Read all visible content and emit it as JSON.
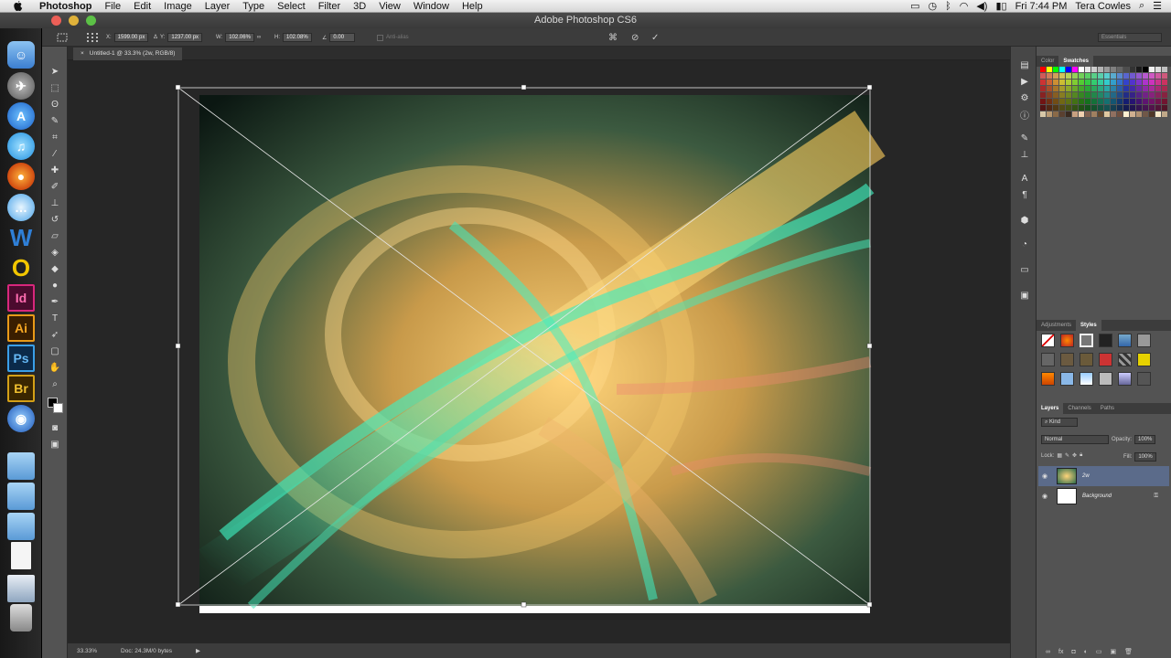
{
  "menubar": {
    "app": "Photoshop",
    "items": [
      "File",
      "Edit",
      "Image",
      "Layer",
      "Type",
      "Select",
      "Filter",
      "3D",
      "View",
      "Window",
      "Help"
    ],
    "clock": "Fri 7:44 PM",
    "user": "Tera Cowles"
  },
  "window": {
    "title": "Adobe Photoshop CS6"
  },
  "options": {
    "x_label": "X:",
    "x_value": "1599.00 px",
    "y_label": "Y:",
    "y_value": "1237.00 px",
    "w_label": "W:",
    "w_value": "102.06%",
    "h_label": "H:",
    "h_value": "102.08%",
    "angle_value": "0.00",
    "antialias": "Anti-alias",
    "workspace": "Essentials"
  },
  "document": {
    "tab_title": "Untitled-1 @ 33.3% (2w, RGB/8)",
    "close": "×"
  },
  "status": {
    "zoom": "33.33%",
    "doc": "Doc: 24.3M/0 bytes"
  },
  "color_panel": {
    "tabs": [
      "Color",
      "Swatches"
    ],
    "active": "Swatches"
  },
  "adjust_panel": {
    "tabs": [
      "Adjustments",
      "Styles"
    ],
    "active": "Styles"
  },
  "layers_panel": {
    "tabs": [
      "Layers",
      "Channels",
      "Paths"
    ],
    "active": "Layers",
    "kind": "Kind",
    "blend_mode": "Normal",
    "opacity_label": "Opacity:",
    "opacity": "100%",
    "lock_label": "Lock:",
    "fill_label": "Fill:",
    "fill": "100%",
    "layers": [
      {
        "name": "2w",
        "selected": true
      },
      {
        "name": "Background",
        "selected": false
      }
    ]
  },
  "dock_icons": [
    "finder-icon",
    "launchpad-icon",
    "app-store-icon",
    "itunes-icon",
    "firefox-icon",
    "messages-icon",
    "word-icon",
    "openoffice-icon",
    "indesign-icon",
    "illustrator-icon",
    "photoshop-icon",
    "bridge-icon",
    "safari-icon",
    "folder-icon",
    "folder-icon",
    "folder-icon",
    "document-icon",
    "preview-icon",
    "trash-icon"
  ],
  "dock_labels": {
    "id": "Id",
    "ai": "Ai",
    "ps": "Ps",
    "br": "Br",
    "w": "W",
    "o": "O"
  }
}
